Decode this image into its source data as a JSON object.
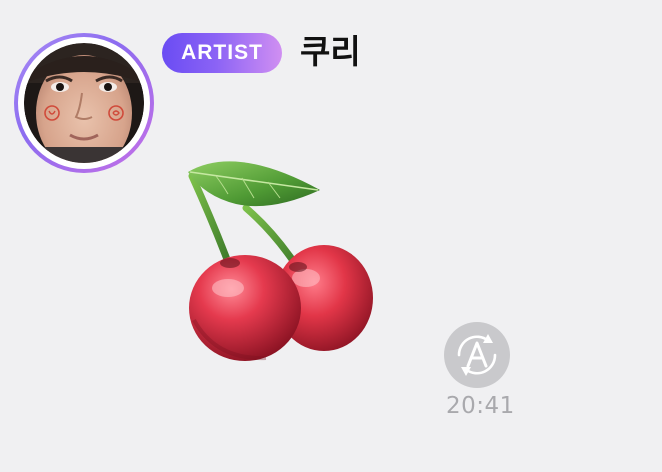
{
  "message": {
    "badge_label": "ARTIST",
    "sender_name": "쿠리",
    "timestamp": "20:41",
    "sticker_icon": "cherry-emoji",
    "translate_icon": "auto-translate-icon"
  },
  "colors": {
    "background": "#f0f0f2",
    "badge_gradient_start": "#6a4cf3",
    "badge_gradient_end": "#d08ff2",
    "avatar_ring_start": "#a98cf5",
    "avatar_ring_end": "#c66fe6",
    "translate_button": "#c9c9cc",
    "timestamp_text": "#a9a9ad"
  }
}
